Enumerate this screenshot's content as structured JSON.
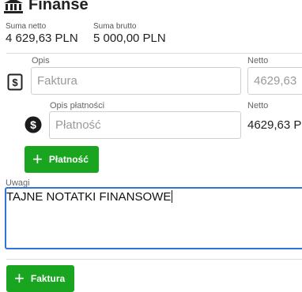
{
  "header": {
    "title": "Finanse",
    "icon": "bank-icon"
  },
  "totals": {
    "netto_label": "Suma netto",
    "netto_value": "4 629,63 PLN",
    "brutto_label": "Suma brutto",
    "brutto_value": "5 000,00 PLN"
  },
  "invoice": {
    "desc_label": "Opis",
    "desc_placeholder": "Faktura",
    "netto_label": "Netto",
    "netto_value": "4629,63",
    "icon": "document-dollar-icon"
  },
  "payment": {
    "desc_label": "Opis płatności",
    "desc_placeholder": "Płatność",
    "netto_label": "Netto",
    "netto_value": "4629,63 P",
    "icon": "dollar-circle-icon",
    "add_label": "Płatność"
  },
  "notes": {
    "label": "Uwagi",
    "value": "TAJNE NOTATKI FINANSOWE"
  },
  "footer": {
    "add_invoice_label": "Faktura"
  },
  "colors": {
    "accent_green": "#1aa521",
    "focus_blue": "#2f76d6"
  }
}
